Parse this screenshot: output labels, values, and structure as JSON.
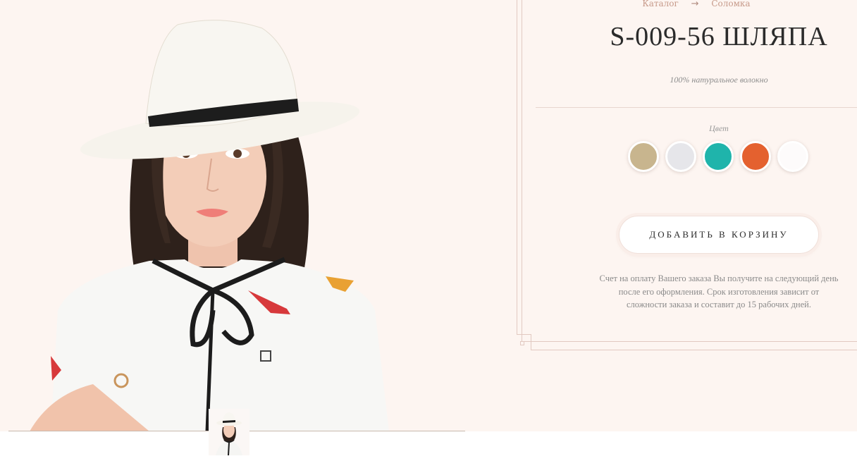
{
  "breadcrumb": {
    "items": [
      "Каталог",
      "Соломка"
    ],
    "separator": "→"
  },
  "product": {
    "title": "S-009-56 ШЛЯПА",
    "material": "100% натуральное волокно"
  },
  "colors": {
    "label": "Цвет",
    "swatches": [
      {
        "name": "beige",
        "hex": "#c8b58e"
      },
      {
        "name": "light-grey",
        "hex": "#e6e6ea"
      },
      {
        "name": "turquoise",
        "hex": "#1fb4ab"
      },
      {
        "name": "orange",
        "hex": "#e4612f"
      },
      {
        "name": "white",
        "hex": "#fdfbfb"
      }
    ]
  },
  "actions": {
    "add_to_cart": "ДОБАВИТЬ В КОРЗИНУ"
  },
  "info": {
    "payment_note": "Счет на оплату Вашего заказа Вы получите на следующий день после его оформления. Срок изготовления зависит от сложности заказа и составит до 15 рабочих дней."
  },
  "images": {
    "main_photo": "woman-in-white-fedora-hat",
    "thumbnail": "woman-in-white-fedora-hat-thumb"
  }
}
